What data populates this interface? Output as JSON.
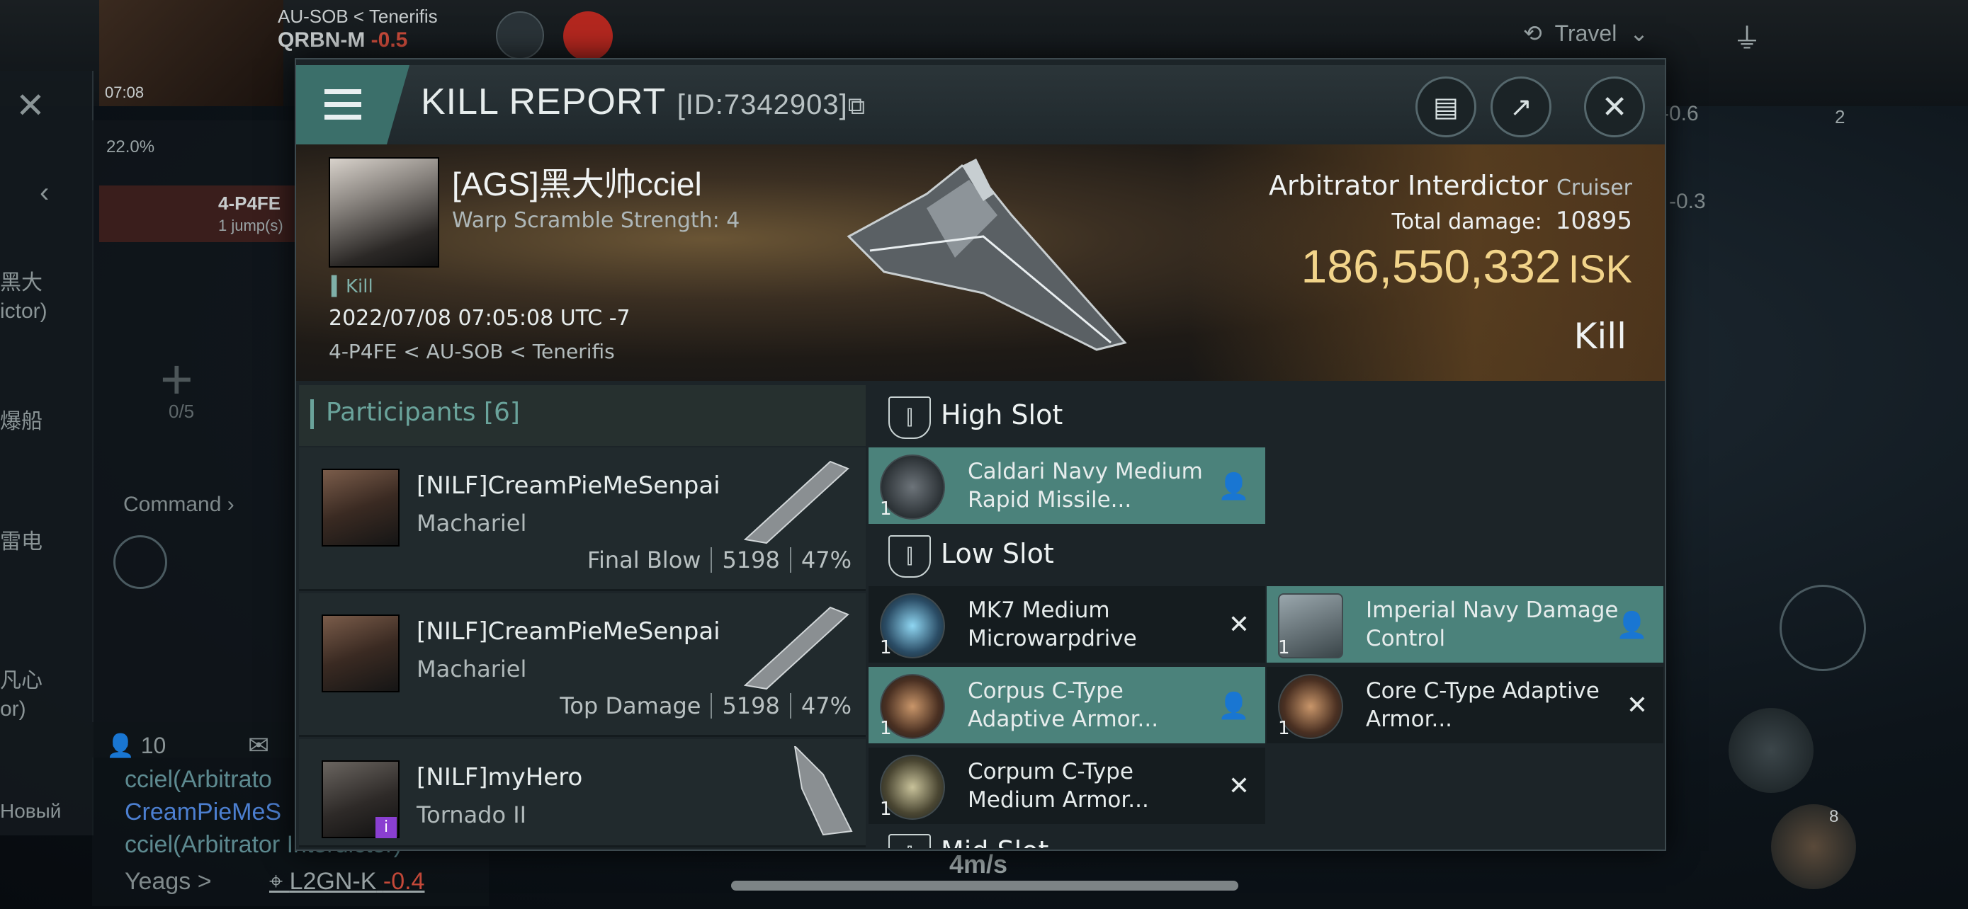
{
  "hud": {
    "location_region": "AU-SOB",
    "location_constellation": "Tenerifis",
    "system": "QRBN-M",
    "system_security": "-0.5",
    "time": "07:08",
    "cargo_percent": "22.0%",
    "nav_target": "4-P4FE",
    "nav_jumps": "1 jump(s)",
    "travel_label": "Travel",
    "sec_right_1": "-0.6",
    "sec_right_2": "-0.3",
    "badge_right": "2",
    "fleet_slots": "0/5",
    "command_label": "Command",
    "online_count": "10",
    "speed": "4m/s",
    "chat_line_1": "cciel(Arbitrato",
    "chat_line_2": "CreamPieMeS",
    "chat_line_3": "cciel(Arbitrator Interdictor)",
    "chat_user": "Yeags",
    "chat_location": "L2GN-K",
    "chat_sec": "-0.4",
    "left_labels": [
      "黑大",
      "ictor)",
      "爆船",
      "雷电",
      "凡心",
      "or)",
      "Новый"
    ],
    "badge_bottom_right": "8"
  },
  "modal": {
    "title": "KILL REPORT",
    "report_id": "[ID:7342903]",
    "victim": {
      "name": "[AGS]黑大帅cciel",
      "warp_scramble": "Warp Scramble Strength: 4",
      "tag": "Kill",
      "datetime": "2022/07/08 07:05:08 UTC -7",
      "location": "4-P4FE < AU-SOB < Tenerifis",
      "ship_name": "Arbitrator Interdictor",
      "ship_class": "Cruiser",
      "total_damage_label": "Total damage:",
      "total_damage": "10895",
      "isk_value": "186,550,332",
      "isk_unit": "ISK",
      "result": "Kill"
    },
    "participants": {
      "label": "Participants",
      "count": "[6]",
      "rows": [
        {
          "name": "[NILF]CreamPieMeSenpai",
          "ship": "Machariel",
          "tag": "Final Blow",
          "damage": "5198",
          "percent": "47%"
        },
        {
          "name": "[NILF]CreamPieMeSenpai",
          "ship": "Machariel",
          "tag": "Top Damage",
          "damage": "5198",
          "percent": "47%"
        },
        {
          "name": "[NILF]myHero",
          "ship": "Tornado II",
          "tag": "",
          "damage": "",
          "percent": ""
        }
      ]
    },
    "slots": {
      "high_label": "High Slot",
      "low_label": "Low Slot",
      "mid_label": "Mid Slot",
      "high": [
        {
          "name": "Caldari Navy Medium Rapid Missile...",
          "qty": "1",
          "status": "dropped"
        }
      ],
      "low": [
        {
          "name": "MK7 Medium Microwarpdrive",
          "qty": "1",
          "status": "destroyed"
        },
        {
          "name": "Imperial Navy Damage Control",
          "qty": "1",
          "status": "dropped"
        },
        {
          "name": "Corpus C-Type Adaptive Armor...",
          "qty": "1",
          "status": "dropped"
        },
        {
          "name": "Core C-Type Adaptive Armor...",
          "qty": "1",
          "status": "destroyed"
        },
        {
          "name": "Corpum C-Type Medium Armor...",
          "qty": "1",
          "status": "destroyed"
        }
      ]
    }
  },
  "colors": {
    "accent": "#4b827b",
    "isk": "#f2d48a",
    "negative_sec": "#c84a3a"
  }
}
